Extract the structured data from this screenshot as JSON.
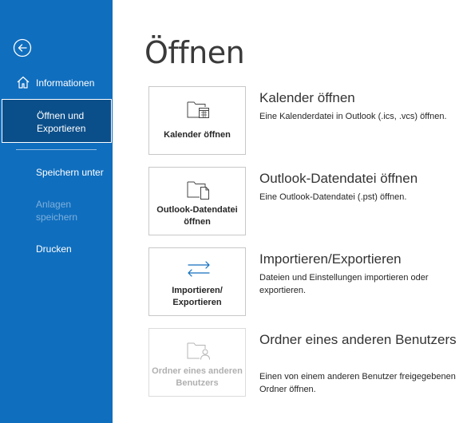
{
  "sidebar": {
    "items": [
      {
        "label": "Informationen"
      },
      {
        "label": "Öffnen und Exportieren"
      },
      {
        "label": "Speichern unter"
      },
      {
        "label": "Anlagen speichern"
      },
      {
        "label": "Drucken"
      }
    ],
    "icons": {
      "back": "back-arrow-circle-icon",
      "home": "home-icon"
    },
    "colors": {
      "background": "#106ebe",
      "selected": "#0b4f8a"
    }
  },
  "main": {
    "title": "Öffnen",
    "options": [
      {
        "tile_label": "Kalender öffnen",
        "title": "Kalender öffnen",
        "description": "Eine Kalenderdatei in Outlook (.ics, .vcs) öffnen.",
        "icon": "calendar-folder-icon"
      },
      {
        "tile_label": "Outlook-Datendatei öffnen",
        "title": "Outlook-Datendatei öffnen",
        "description": "Eine Outlook-Datendatei (.pst) öffnen.",
        "icon": "data-file-folder-icon"
      },
      {
        "tile_label": "Importieren/ Exportieren",
        "title": "Importieren/Exportieren",
        "description": "Dateien und Einstellungen importieren oder exportieren.",
        "icon": "import-export-arrows-icon"
      },
      {
        "tile_label": "Ordner eines anderen Benutzers",
        "title": "Ordner eines anderen Benutzers",
        "description": "Einen von einem anderen Benutzer freigegebenen Ordner öffnen.",
        "icon": "shared-user-folder-icon"
      }
    ]
  }
}
